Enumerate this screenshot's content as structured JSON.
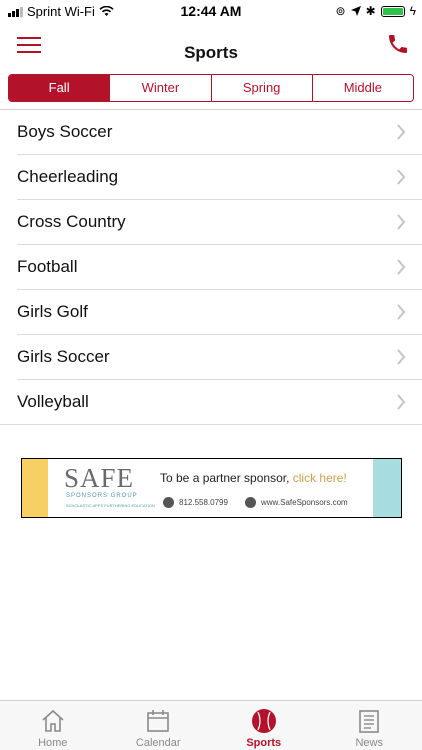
{
  "status_bar": {
    "carrier": "Sprint Wi-Fi",
    "time": "12:44 AM",
    "battery_color": "#2fc24a"
  },
  "header": {
    "title": "Sports",
    "menu_icon": "hamburger-menu-icon",
    "phone_icon": "phone-icon"
  },
  "segments": {
    "items": [
      "Fall",
      "Winter",
      "Spring",
      "Middle"
    ],
    "selected": "Fall"
  },
  "sports": {
    "items": [
      "Boys Soccer",
      "Cheerleading",
      "Cross Country",
      "Football",
      "Girls Golf",
      "Girls Soccer",
      "Volleyball"
    ]
  },
  "banner": {
    "logo": "SAFE",
    "logo_sub": "SPONSORS GROUP",
    "logo_tag": "SCHOLASTIC APPS FURTHERING EDUCATION",
    "text": "To be a partner sponsor,",
    "link": "click here!",
    "phone": "812.558.0799",
    "website": "www.SafeSponsors.com"
  },
  "tabbar": {
    "items": [
      {
        "label": "Home",
        "icon": "home-icon"
      },
      {
        "label": "Calendar",
        "icon": "calendar-icon"
      },
      {
        "label": "Sports",
        "icon": "baseball-icon"
      },
      {
        "label": "News",
        "icon": "news-icon"
      }
    ],
    "active": "Sports"
  },
  "colors": {
    "accent": "#b3132a",
    "inactive": "#8a8a8a"
  }
}
